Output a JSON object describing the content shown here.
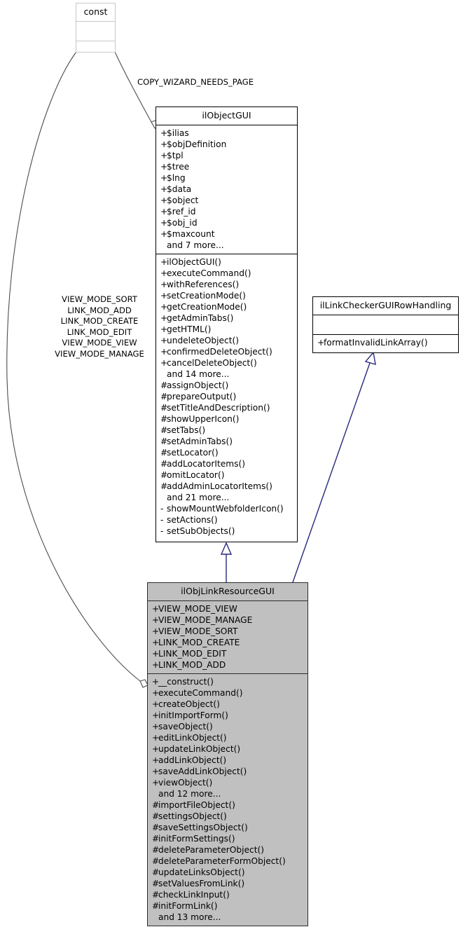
{
  "diagram": {
    "kind": "uml-class-diagram",
    "colors": {
      "background": "#ffffff",
      "box_fill_plain": "#ffffff",
      "box_fill_highlight": "#c0c0c0",
      "box_border": "#000000",
      "box_border_ghost": "#c8c8c8",
      "inheritance_edge": "#27287e",
      "association_edge": "#4d4d4d",
      "text": "#000000"
    },
    "classes": [
      {
        "id": "const",
        "name": "const",
        "style": "ghost",
        "attributes": [],
        "operations": []
      },
      {
        "id": "ilObjectGUI",
        "name": "ilObjectGUI",
        "style": "plain",
        "attributes": [
          {
            "vis": "+",
            "text": "$ilias"
          },
          {
            "vis": "+",
            "text": "$objDefinition"
          },
          {
            "vis": "+",
            "text": "$tpl"
          },
          {
            "vis": "+",
            "text": "$tree"
          },
          {
            "vis": "+",
            "text": "$lng"
          },
          {
            "vis": "+",
            "text": "$data"
          },
          {
            "vis": "+",
            "text": "$object"
          },
          {
            "vis": "+",
            "text": "$ref_id"
          },
          {
            "vis": "+",
            "text": "$obj_id"
          },
          {
            "vis": "+",
            "text": "$maxcount"
          },
          {
            "vis": "",
            "text": "and 7 more..."
          }
        ],
        "operations": [
          {
            "vis": "+",
            "text": "ilObjectGUI()"
          },
          {
            "vis": "+",
            "text": "executeCommand()"
          },
          {
            "vis": "+",
            "text": "withReferences()"
          },
          {
            "vis": "+",
            "text": "setCreationMode()"
          },
          {
            "vis": "+",
            "text": "getCreationMode()"
          },
          {
            "vis": "+",
            "text": "getAdminTabs()"
          },
          {
            "vis": "+",
            "text": "getHTML()"
          },
          {
            "vis": "+",
            "text": "undeleteObject()"
          },
          {
            "vis": "+",
            "text": "confirmedDeleteObject()"
          },
          {
            "vis": "+",
            "text": "cancelDeleteObject()"
          },
          {
            "vis": "",
            "text": "and 14 more..."
          },
          {
            "vis": "#",
            "text": "assignObject()"
          },
          {
            "vis": "#",
            "text": "prepareOutput()"
          },
          {
            "vis": "#",
            "text": "setTitleAndDescription()"
          },
          {
            "vis": "#",
            "text": "showUpperIcon()"
          },
          {
            "vis": "#",
            "text": "setTabs()"
          },
          {
            "vis": "#",
            "text": "setAdminTabs()"
          },
          {
            "vis": "#",
            "text": "setLocator()"
          },
          {
            "vis": "#",
            "text": "addLocatorItems()"
          },
          {
            "vis": "#",
            "text": "omitLocator()"
          },
          {
            "vis": "#",
            "text": "addAdminLocatorItems()"
          },
          {
            "vis": "",
            "text": "and 21 more..."
          },
          {
            "vis": "-",
            "text": "showMountWebfolderIcon()"
          },
          {
            "vis": "-",
            "text": "setActions()"
          },
          {
            "vis": "-",
            "text": "setSubObjects()"
          }
        ]
      },
      {
        "id": "ilLinkCheckerGUIRowHandling",
        "name": "ilLinkCheckerGUIRowHandling",
        "style": "plain",
        "attributes": [],
        "operations": [
          {
            "vis": "+",
            "text": "formatInvalidLinkArray()"
          }
        ]
      },
      {
        "id": "ilObjLinkResourceGUI",
        "name": "ilObjLinkResourceGUI",
        "style": "highlight",
        "attributes": [
          {
            "vis": "+",
            "text": "VIEW_MODE_VIEW"
          },
          {
            "vis": "+",
            "text": "VIEW_MODE_MANAGE"
          },
          {
            "vis": "+",
            "text": "VIEW_MODE_SORT"
          },
          {
            "vis": "+",
            "text": "LINK_MOD_CREATE"
          },
          {
            "vis": "+",
            "text": "LINK_MOD_EDIT"
          },
          {
            "vis": "+",
            "text": "LINK_MOD_ADD"
          }
        ],
        "operations": [
          {
            "vis": "+",
            "text": "__construct()"
          },
          {
            "vis": "+",
            "text": "executeCommand()"
          },
          {
            "vis": "+",
            "text": "createObject()"
          },
          {
            "vis": "+",
            "text": "initImportForm()"
          },
          {
            "vis": "+",
            "text": "saveObject()"
          },
          {
            "vis": "+",
            "text": "editLinkObject()"
          },
          {
            "vis": "+",
            "text": "updateLinkObject()"
          },
          {
            "vis": "+",
            "text": "addLinkObject()"
          },
          {
            "vis": "+",
            "text": "saveAddLinkObject()"
          },
          {
            "vis": "+",
            "text": "viewObject()"
          },
          {
            "vis": "",
            "text": "and 12 more..."
          },
          {
            "vis": "#",
            "text": "importFileObject()"
          },
          {
            "vis": "#",
            "text": "settingsObject()"
          },
          {
            "vis": "#",
            "text": "saveSettingsObject()"
          },
          {
            "vis": "#",
            "text": "initFormSettings()"
          },
          {
            "vis": "#",
            "text": "deleteParameterObject()"
          },
          {
            "vis": "#",
            "text": "deleteParameterFormObject()"
          },
          {
            "vis": "#",
            "text": "updateLinksObject()"
          },
          {
            "vis": "#",
            "text": "setValuesFromLink()"
          },
          {
            "vis": "#",
            "text": "checkLinkInput()"
          },
          {
            "vis": "#",
            "text": "initFormLink()"
          },
          {
            "vis": "",
            "text": "and 13 more..."
          }
        ]
      }
    ],
    "edge_labels": {
      "const_to_ilObjectGUI": "COPY_WIZARD_NEEDS_PAGE",
      "const_to_ilObjLinkResourceGUI": [
        "VIEW_MODE_SORT",
        "LINK_MOD_ADD",
        "LINK_MOD_CREATE",
        "LINK_MOD_EDIT",
        "VIEW_MODE_VIEW",
        "VIEW_MODE_MANAGE"
      ]
    }
  }
}
